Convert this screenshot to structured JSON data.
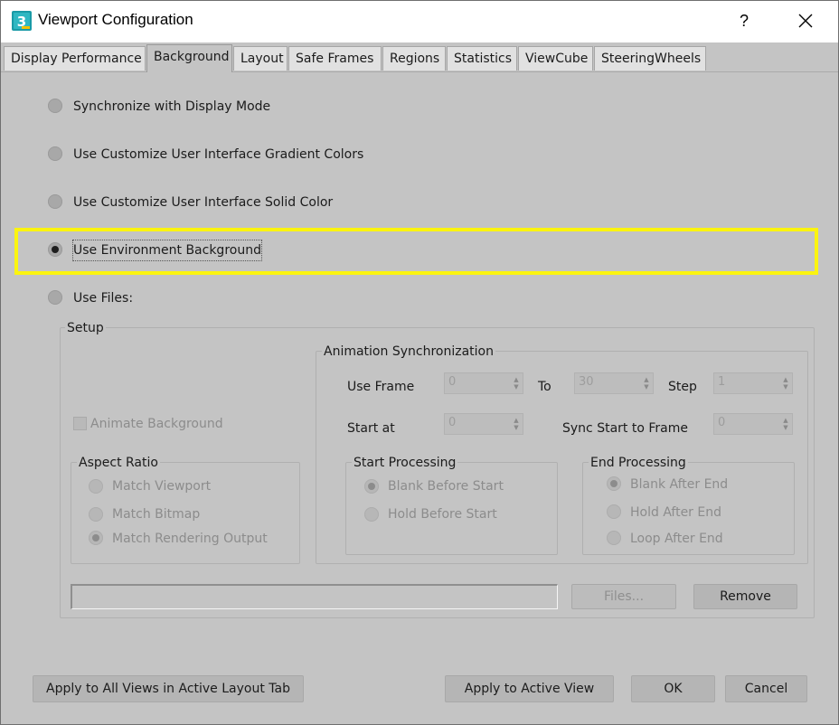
{
  "window": {
    "title": "Viewport Configuration",
    "help_label": "?",
    "accent_highlight": "#fbf40f"
  },
  "tabs": [
    {
      "label": "Display Performance",
      "active": false
    },
    {
      "label": "Background",
      "active": true
    },
    {
      "label": "Layout",
      "active": false
    },
    {
      "label": "Safe Frames",
      "active": false
    },
    {
      "label": "Regions",
      "active": false
    },
    {
      "label": "Statistics",
      "active": false
    },
    {
      "label": "ViewCube",
      "active": false
    },
    {
      "label": "SteeringWheels",
      "active": false
    }
  ],
  "background_options": [
    {
      "label": "Synchronize with Display Mode",
      "checked": false
    },
    {
      "label": "Use Customize User Interface Gradient Colors",
      "checked": false
    },
    {
      "label": "Use Customize User Interface Solid Color",
      "checked": false
    },
    {
      "label": "Use Environment Background",
      "checked": true
    },
    {
      "label": "Use Files:",
      "checked": false
    }
  ],
  "setup": {
    "title": "Setup",
    "animate_background_label": "Animate Background",
    "aspect_ratio": {
      "title": "Aspect Ratio",
      "options": [
        {
          "label": "Match Viewport",
          "checked": false
        },
        {
          "label": "Match Bitmap",
          "checked": false
        },
        {
          "label": "Match Rendering Output",
          "checked": true
        }
      ]
    },
    "animation_sync": {
      "title": "Animation Synchronization",
      "use_frame_label": "Use Frame",
      "use_frame_value": "0",
      "to_label": "To",
      "to_value": "30",
      "step_label": "Step",
      "step_value": "1",
      "start_at_label": "Start at",
      "start_at_value": "0",
      "sync_start_label": "Sync Start to Frame",
      "sync_start_value": "0",
      "start_processing": {
        "title": "Start Processing",
        "options": [
          {
            "label": "Blank Before Start",
            "checked": true
          },
          {
            "label": "Hold Before Start",
            "checked": false
          }
        ]
      },
      "end_processing": {
        "title": "End Processing",
        "options": [
          {
            "label": "Blank After End",
            "checked": true
          },
          {
            "label": "Hold After End",
            "checked": false
          },
          {
            "label": "Loop After End",
            "checked": false
          }
        ]
      }
    },
    "file_path_value": "",
    "files_button": "Files...",
    "remove_button": "Remove"
  },
  "footer": {
    "apply_all_label": "Apply to All Views in Active Layout Tab",
    "apply_active_label": "Apply to Active View",
    "ok_label": "OK",
    "cancel_label": "Cancel"
  }
}
